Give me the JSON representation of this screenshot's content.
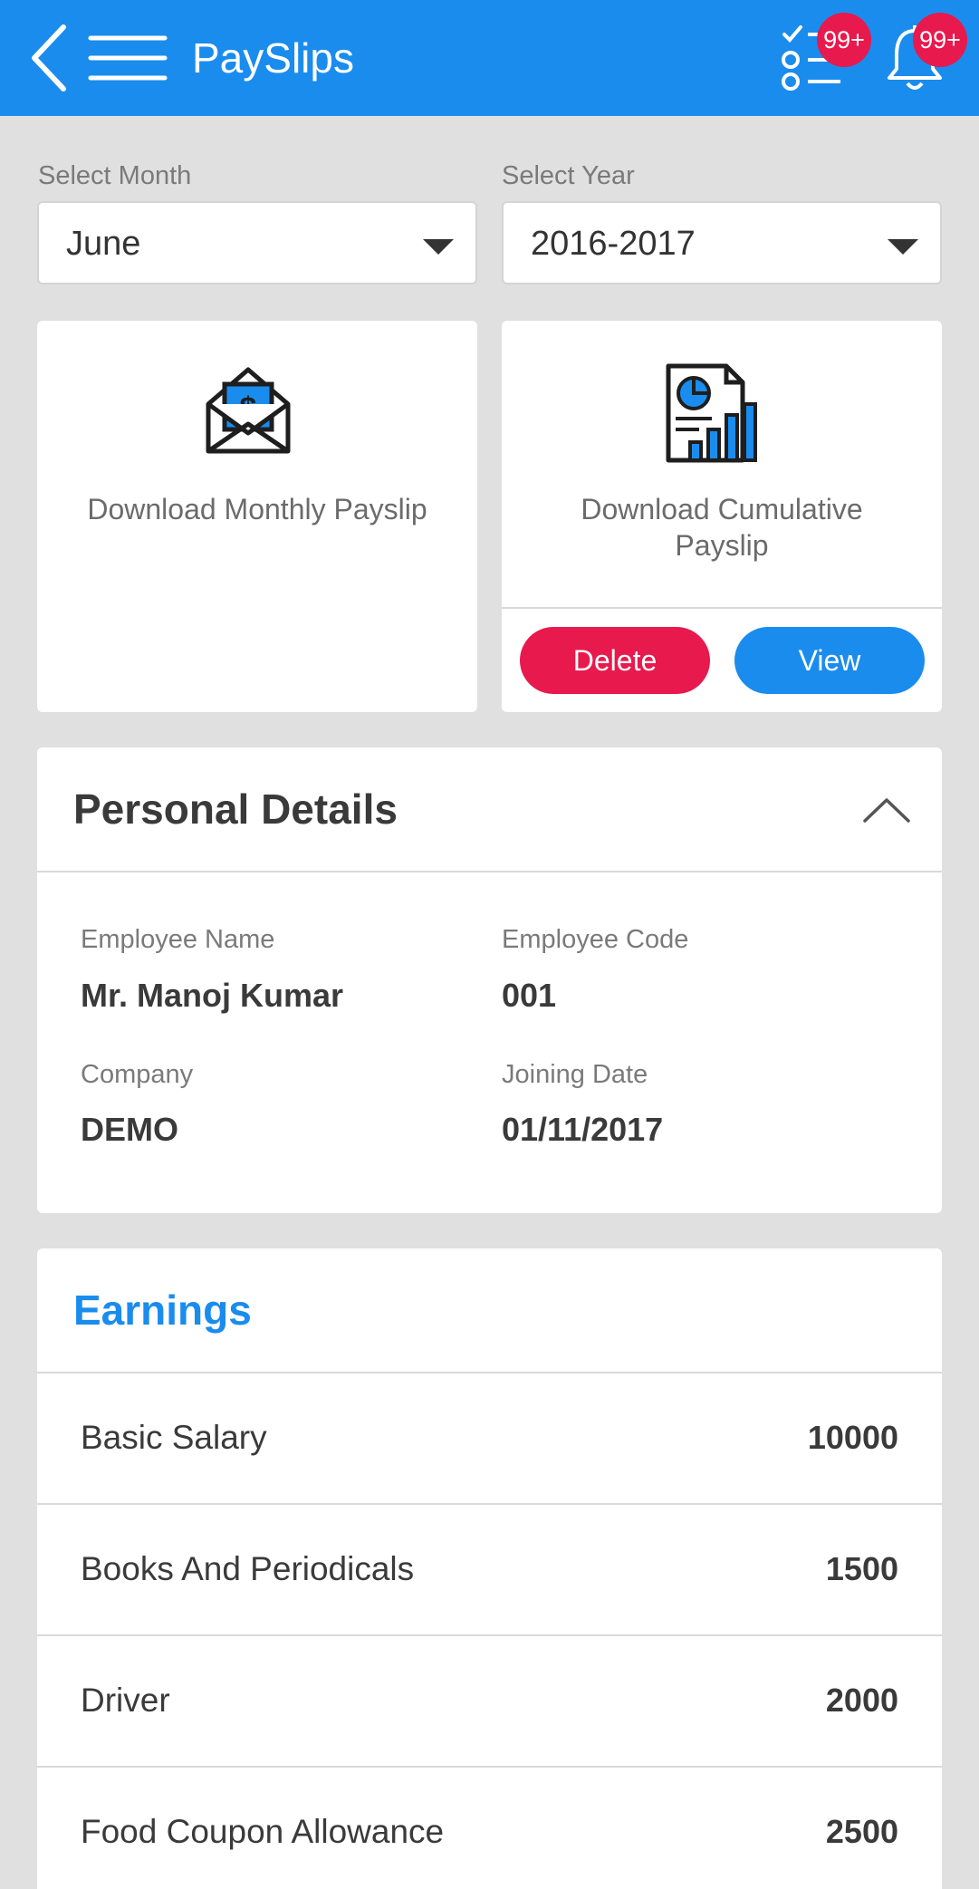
{
  "appbar": {
    "title": "PaySlips",
    "tasks_badge": "99+",
    "notifications_badge": "99+",
    "color": "#1a8cee"
  },
  "filters": {
    "month_label": "Select Month",
    "month_value": "June",
    "year_label": "Select Year",
    "year_value": "2016-2017"
  },
  "cards": {
    "monthly_label": "Download Monthly Payslip",
    "cumulative_label": "Download Cumulative Payslip",
    "delete_label": "Delete",
    "view_label": "View",
    "delete_color": "#e8194d",
    "view_color": "#1a8cee"
  },
  "personal": {
    "title": "Personal Details",
    "employee_name_label": "Employee Name",
    "employee_name": "Mr. Manoj Kumar",
    "employee_code_label": "Employee Code",
    "employee_code": "001",
    "company_label": "Company",
    "company": "DEMO",
    "joining_date_label": "Joining Date",
    "joining_date": "01/11/2017"
  },
  "earnings": {
    "title": "Earnings",
    "title_color": "#1a8cee",
    "rows": [
      {
        "label": "Basic Salary",
        "value": "10000"
      },
      {
        "label": "Books And Periodicals",
        "value": "1500"
      },
      {
        "label": "Driver",
        "value": "2000"
      },
      {
        "label": "Food Coupon Allowance",
        "value": "2500"
      }
    ]
  }
}
